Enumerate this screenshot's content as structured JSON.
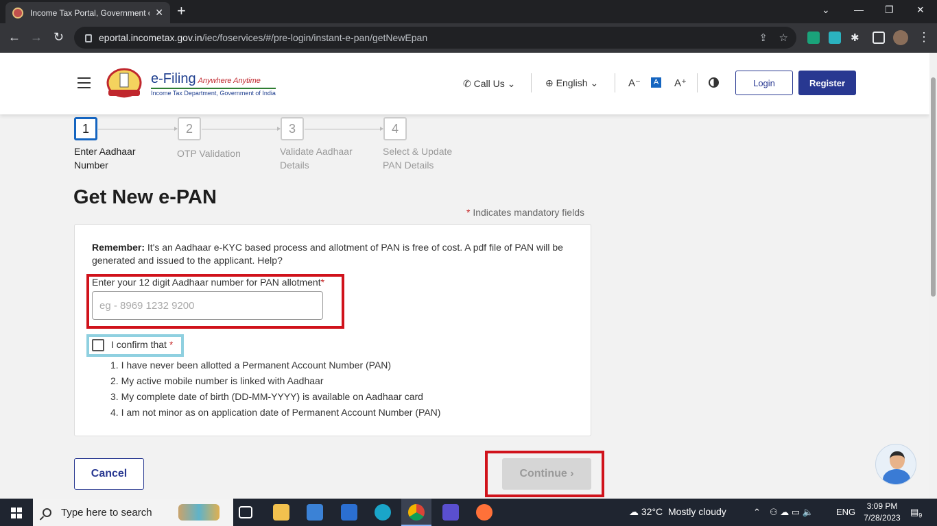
{
  "browser": {
    "tab_title": "Income Tax Portal, Government o",
    "url_domain": "eportal.incometax.gov.in",
    "url_path": "/iec/foservices/#/pre-login/instant-e-pan/getNewEpan"
  },
  "header": {
    "brand_title": "e-Filing",
    "brand_tagline": "Anywhere Anytime",
    "brand_subtitle": "Income Tax Department, Government of India",
    "call_us": "Call Us",
    "language": "English",
    "font_decrease": "A⁻",
    "font_normal": "A",
    "font_increase": "A⁺",
    "login": "Login",
    "register": "Register"
  },
  "stepper": {
    "steps": [
      {
        "number": "1",
        "label": "Enter Aadhaar Number",
        "active": true
      },
      {
        "number": "2",
        "label": "OTP Validation",
        "active": false
      },
      {
        "number": "3",
        "label": "Validate Aadhaar Details",
        "active": false
      },
      {
        "number": "4",
        "label": "Select & Update PAN Details",
        "active": false
      }
    ]
  },
  "form": {
    "title": "Get New e-PAN",
    "mandatory_note": "Indicates mandatory fields",
    "remember_label": "Remember:",
    "remember_text": "It's an Aadhaar e-KYC based process and allotment of PAN is free of cost. A pdf file of PAN will be generated and issued to the applicant. Help?",
    "aadhaar_label": "Enter your 12 digit Aadhaar number for PAN allotment",
    "aadhaar_placeholder": "eg - 8969 1232 9200",
    "aadhaar_value": "",
    "confirm_label": "I confirm that",
    "confirm_checked": false,
    "conditions": [
      "1. I have never been allotted a Permanent Account Number (PAN)",
      "2. My active mobile number is linked with Aadhaar",
      "3. My complete date of birth (DD-MM-YYYY) is available on Aadhaar card",
      "4. I am not minor as on application date of Permanent Account Number (PAN)"
    ],
    "cancel": "Cancel",
    "continue": "Continue"
  },
  "taskbar": {
    "search_placeholder": "Type here to search",
    "weather_temp": "32°C",
    "weather_desc": "Mostly cloudy",
    "language": "ENG",
    "time": "3:09 PM",
    "date": "7/28/2023",
    "notification_count": "9"
  },
  "colors": {
    "brand_navy": "#283891",
    "step_active": "#1565c0",
    "highlight_red": "#d0121b",
    "highlight_blue": "#8fd0e0",
    "required_star": "#c62828"
  }
}
